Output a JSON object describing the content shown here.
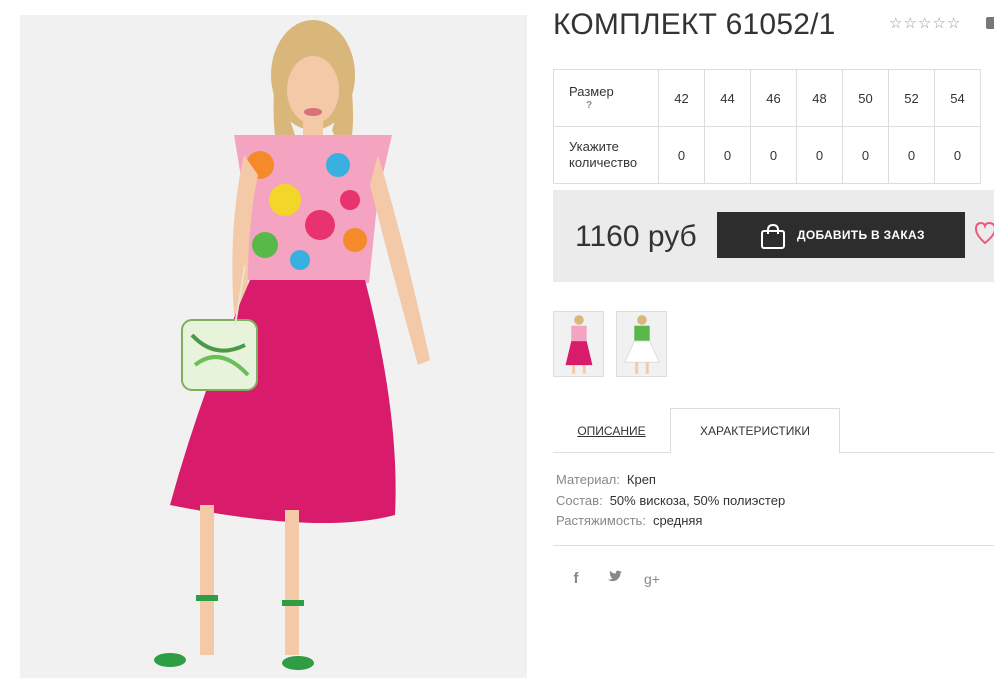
{
  "product": {
    "title": "КОМПЛЕКТ 61052/1",
    "rating_stars": [
      "☆",
      "☆",
      "☆",
      "☆",
      "☆"
    ]
  },
  "sizes": {
    "row_label": "Размер",
    "help": "?",
    "values": [
      "42",
      "44",
      "46",
      "48",
      "50",
      "52",
      "54"
    ],
    "qty_label_1": "Укажите",
    "qty_label_2": "количество",
    "quantities": [
      "0",
      "0",
      "0",
      "0",
      "0",
      "0",
      "0"
    ]
  },
  "purchase": {
    "price": "1160 руб",
    "add_button": "ДОБАВИТЬ В ЗАКАЗ",
    "accent_dark": "#2d2d2d"
  },
  "tabs": {
    "description": "ОПИСАНИЕ",
    "characteristics": "ХАРАКТЕРИСТИКИ"
  },
  "specs": [
    {
      "key": "Материал:",
      "value": "Креп"
    },
    {
      "key": "Состав:",
      "value": "50% вискоза, 50% полиэстер"
    },
    {
      "key": "Растяжимость:",
      "value": "средняя"
    }
  ],
  "social": {
    "facebook": "f",
    "twitter": "🐦",
    "gplus": "g+"
  },
  "colors": {
    "skirt": "#d81b6a",
    "top_floral": "#f4a3c0",
    "sandals": "#2e9d44",
    "background": "#f1f1f1"
  }
}
